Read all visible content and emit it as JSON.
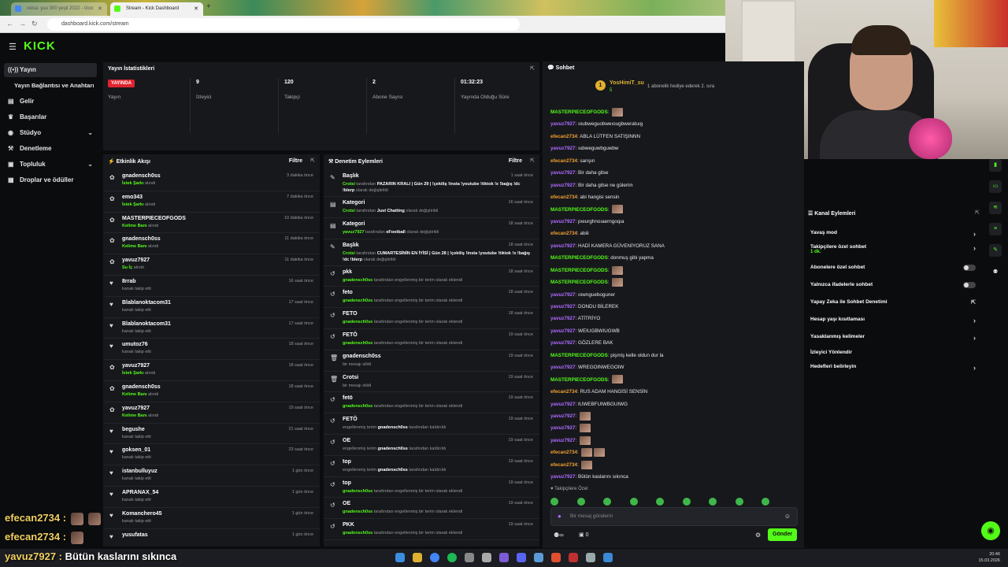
{
  "browser": {
    "tabs": [
      {
        "label": "velsa: yuu 300 yeşil 2022 - Goo"
      },
      {
        "label": "Stream - Kick Dashboard"
      }
    ],
    "url": "dashboard.kick.com/stream"
  },
  "sidebar": {
    "items": [
      {
        "label": "Yayın",
        "icon": "broadcast-icon"
      },
      {
        "label": "Yayın Bağlantısı ve Anahtarı",
        "icon": "key-icon"
      },
      {
        "label": "Gelir",
        "icon": "wallet-icon"
      },
      {
        "label": "Başarılar",
        "icon": "trophy-icon"
      },
      {
        "label": "Stüdyo",
        "icon": "studio-icon"
      },
      {
        "label": "Denetleme",
        "icon": "hammer-icon"
      },
      {
        "label": "Topluluk",
        "icon": "community-icon"
      },
      {
        "label": "Droplar ve ödüller",
        "icon": "gift-icon"
      }
    ]
  },
  "stats": {
    "title": "Yayın İstatistikleri",
    "live_badge": "YAYINDA",
    "items": [
      {
        "value": "",
        "label": "Yayın"
      },
      {
        "value": "9",
        "label": "İzleyici"
      },
      {
        "value": "120",
        "label": "Takipçi"
      },
      {
        "value": "2",
        "label": "Abone Sayısı"
      },
      {
        "value": "01:32:23",
        "label": "Yayında Olduğu Süre"
      }
    ]
  },
  "activity": {
    "title": "Etkinlik Akışı",
    "filter": "Filtre",
    "rows": [
      {
        "name": "gnadensch0ss",
        "action": "İstek Şarkı",
        "rest": " alındı",
        "time": "3 dakika önce",
        "icon": "reward-icon"
      },
      {
        "name": "emo343",
        "action": "İstek Şarkı",
        "rest": " alındı",
        "time": "7 dakika önce",
        "icon": "reward-icon"
      },
      {
        "name": "MASTERPIECEOFGODS",
        "action": "Kelime Banı",
        "rest": " alındı",
        "time": "10 dakika önce",
        "icon": "reward-icon"
      },
      {
        "name": "gnadensch0ss",
        "action": "Kelime Banı",
        "rest": " alındı",
        "time": "11 dakika önce",
        "icon": "reward-icon"
      },
      {
        "name": "yavuz7927",
        "action": "Su İç",
        "rest": " alındı",
        "time": "11 dakika önce",
        "icon": "reward-icon"
      },
      {
        "name": "8rrab",
        "action": "",
        "rest": "kanalı takip etti",
        "time": "16 saat önce",
        "icon": "heart-icon"
      },
      {
        "name": "Blablanoktacom31",
        "action": "",
        "rest": "kanalı takip etti",
        "time": "17 saat önce",
        "icon": "heart-icon"
      },
      {
        "name": "Blablanoktacom31",
        "action": "",
        "rest": "kanalı takip etti",
        "time": "17 saat önce",
        "icon": "heart-icon"
      },
      {
        "name": "umutoz76",
        "action": "",
        "rest": "kanalı takip etti",
        "time": "18 saat önce",
        "icon": "heart-icon"
      },
      {
        "name": "yavuz7927",
        "action": "İstek Şarkı",
        "rest": " alındı",
        "time": "18 saat önce",
        "icon": "reward-icon"
      },
      {
        "name": "gnadensch0ss",
        "action": "Kelime Banı",
        "rest": " alındı",
        "time": "18 saat önce",
        "icon": "reward-icon"
      },
      {
        "name": "yavuz7927",
        "action": "Kelime Banı",
        "rest": " alındı",
        "time": "19 saat önce",
        "icon": "reward-icon"
      },
      {
        "name": "begushe",
        "action": "",
        "rest": "kanalı takip etti",
        "time": "21 saat önce",
        "icon": "heart-icon"
      },
      {
        "name": "goksen_01",
        "action": "",
        "rest": "kanalı takip etti",
        "time": "23 saat önce",
        "icon": "heart-icon"
      },
      {
        "name": "istanbulluyuz",
        "action": "",
        "rest": "kanalı takip etti",
        "time": "1 gün önce",
        "icon": "heart-icon"
      },
      {
        "name": "APRANAX_54",
        "action": "",
        "rest": "kanalı takip etti",
        "time": "1 gün önce",
        "icon": "heart-icon"
      },
      {
        "name": "Komanchero45",
        "action": "",
        "rest": "kanalı takip etti",
        "time": "1 gün önce",
        "icon": "heart-icon"
      },
      {
        "name": "yusufatas",
        "action": "",
        "rest": "",
        "time": "1 gün önce",
        "icon": "heart-icon"
      }
    ]
  },
  "moderation": {
    "title": "Denetim Eylemleri",
    "filter": "Filtre",
    "rows": [
      {
        "title": "Başlık",
        "user": "Crotsi",
        "mid": " tarafından ",
        "hl": "PAZARIN KRALI | Gün 29 | !çekiliş !insta !youtube !tiktok !x !bağış !dc !blerp",
        "end": " olarak değiştirildi",
        "time": "1 saat önce",
        "icon": "title-icon"
      },
      {
        "title": "Kategori",
        "user": "Crotsi",
        "mid": " tarafından ",
        "hl": "Just Chatting",
        "end": " olarak değiştirildi",
        "time": "16 saat önce",
        "icon": "category-icon"
      },
      {
        "title": "Kategori",
        "user": "yavuz7927",
        "mid": " tarafından ",
        "hl": "eFootball",
        "end": " olarak değiştirildi",
        "time": "18 saat önce",
        "icon": "category-icon"
      },
      {
        "title": "Başlık",
        "user": "Crotsi",
        "mid": " tarafından ",
        "hl": "CUMARTESİNİN EN İYİSİ | Gün 28 | !çekiliş !insta !youtube !tiktok !x !bağış !dc !blerp",
        "end": " olarak değiştirildi",
        "time": "18 saat önce",
        "icon": "title-icon"
      },
      {
        "title": "pkk",
        "user": "gnadensch0ss",
        "mid": " tarafından engellenmiş bir terim olarak eklendi",
        "hl": "",
        "end": "",
        "time": "18 saat önce",
        "icon": "undo-icon"
      },
      {
        "title": "feto",
        "user": "gnadensch0ss",
        "mid": " tarafından engellenmiş bir terim olarak eklendi",
        "hl": "",
        "end": "",
        "time": "18 saat önce",
        "icon": "undo-icon"
      },
      {
        "title": "FETO",
        "user": "gnadensch0ss",
        "mid": " tarafından engellenmiş bir terim olarak eklendi",
        "hl": "",
        "end": "",
        "time": "18 saat önce",
        "icon": "undo-icon"
      },
      {
        "title": "FETÖ",
        "user": "gnadensch0ss",
        "mid": " tarafından engellenmiş bir terim olarak eklendi",
        "hl": "",
        "end": "",
        "time": "19 saat önce",
        "icon": "undo-icon"
      },
      {
        "title": "gnadensch0ss",
        "user": "",
        "mid": "bir mesajı silidi",
        "hl": "",
        "end": "",
        "time": "19 saat önce",
        "icon": "trash-icon"
      },
      {
        "title": "Crotsi",
        "user": "",
        "mid": "bir mesajı silidi",
        "hl": "",
        "end": "",
        "time": "19 saat önce",
        "icon": "trash-icon"
      },
      {
        "title": "fetö",
        "user": "gnadensch0ss",
        "mid": " tarafından engellenmiş bir terim olarak eklendi",
        "hl": "",
        "end": "",
        "time": "19 saat önce",
        "icon": "undo-icon"
      },
      {
        "title": "FETÖ",
        "user": "",
        "mid": "engellenmiş terim ",
        "hl": "gnadensch0ss",
        "end": " tarafından kaldırıldı",
        "time": "19 saat önce",
        "icon": "undo-icon"
      },
      {
        "title": "OE",
        "user": "",
        "mid": "engellenmiş terim ",
        "hl": "gnadensch0ss",
        "end": " tarafından kaldırıldı",
        "time": "19 saat önce",
        "icon": "undo-icon"
      },
      {
        "title": "top",
        "user": "",
        "mid": "engellenmiş terim ",
        "hl": "gnadensch0ss",
        "end": " tarafından kaldırıldı",
        "time": "19 saat önce",
        "icon": "undo-icon"
      },
      {
        "title": "top",
        "user": "gnadensch0ss",
        "mid": " tarafından engellenmiş bir terim olarak eklendi",
        "hl": "",
        "end": "",
        "time": "19 saat önce",
        "icon": "undo-icon"
      },
      {
        "title": "OE",
        "user": "gnadensch0ss",
        "mid": " tarafından engellenmiş bir terim olarak eklendi",
        "hl": "",
        "end": "",
        "time": "19 saat önce",
        "icon": "undo-icon"
      },
      {
        "title": "PKK",
        "user": "gnadensch0ss",
        "mid": " tarafından engellenmiş bir terim olarak eklendi",
        "hl": "",
        "end": "",
        "time": "19 saat önce",
        "icon": "undo-icon"
      }
    ]
  },
  "chat": {
    "title": "Sohbet",
    "pinned_user": "YosHimiT_su",
    "pinned_count": "5",
    "pinned_msg": "1 abonelik hediye ederek 2. sıra",
    "messages": [
      {
        "user": "MASTERPIECEOFGODS",
        "color": "g",
        "text": "",
        "emotes": 1
      },
      {
        "user": "yavuz7927",
        "color": "p",
        "text": "ıoubweguobweıougbweratuıg",
        "emotes": 0
      },
      {
        "user": "efecan2734",
        "color": "o",
        "text": "ABLA LÜTFEN SATIŞINNN",
        "emotes": 0
      },
      {
        "user": "yavuz7927",
        "color": "p",
        "text": "ıubweguwbguwbw",
        "emotes": 0
      },
      {
        "user": "efecan2734",
        "color": "o",
        "text": "sarışın",
        "emotes": 0
      },
      {
        "user": "yavuz7927",
        "color": "p",
        "text": "Bir daha gitse",
        "emotes": 0
      },
      {
        "user": "yavuz7927",
        "color": "p",
        "text": "Bir daha gitse ne gülerim",
        "emotes": 0
      },
      {
        "user": "efecan2734",
        "color": "o",
        "text": "abi hangisi sensin",
        "emotes": 0
      },
      {
        "user": "MASTERPIECEOFGODS",
        "color": "g",
        "text": "",
        "emotes": 1
      },
      {
        "user": "yavuz7927",
        "color": "p",
        "text": "pıeurghnoıaerngoqıa",
        "emotes": 0
      },
      {
        "user": "efecan2734",
        "color": "o",
        "text": "abiii",
        "emotes": 0
      },
      {
        "user": "yavuz7927",
        "color": "p",
        "text": "HADİ KAMERA GÜVENİYORUZ SANA",
        "emotes": 0
      },
      {
        "user": "MASTERPIECEOFGODS",
        "color": "g",
        "text": "donmuş gibi yapma",
        "emotes": 0
      },
      {
        "user": "MASTERPIECEOFGODS",
        "color": "g",
        "text": "",
        "emotes": 1
      },
      {
        "user": "MASTERPIECEOFGODS",
        "color": "g",
        "text": "",
        "emotes": 1
      },
      {
        "user": "yavuz7927",
        "color": "p",
        "text": "ıowngueboguner",
        "emotes": 0
      },
      {
        "user": "yavuz7927",
        "color": "p",
        "text": "DONDU BİLEREK",
        "emotes": 0
      },
      {
        "user": "yavuz7927",
        "color": "p",
        "text": "ATİTRİYO",
        "emotes": 0
      },
      {
        "user": "yavuz7927",
        "color": "p",
        "text": "WEIUGBWIUGWB",
        "emotes": 0
      },
      {
        "user": "yavuz7927",
        "color": "p",
        "text": "GÖZLERE BAK",
        "emotes": 0
      },
      {
        "user": "MASTERPIECEOFGODS",
        "color": "g",
        "text": "pişmiş kelle oldun dur la",
        "emotes": 0
      },
      {
        "user": "yavuz7927",
        "color": "p",
        "text": "WREGOINWEGOIW",
        "emotes": 0
      },
      {
        "user": "MASTERPIECEOFGODS",
        "color": "g",
        "text": "",
        "emotes": 1
      },
      {
        "user": "efecan2734",
        "color": "o",
        "text": "RUS ADAM HANGİSİ SENSİN",
        "emotes": 0
      },
      {
        "user": "yavuz7927",
        "color": "p",
        "text": "IUWEBFUIWBGUIWG",
        "emotes": 0
      },
      {
        "user": "yavuz7927",
        "color": "p",
        "text": "",
        "emotes": 1
      },
      {
        "user": "yavuz7927",
        "color": "p",
        "text": "",
        "emotes": 1
      },
      {
        "user": "yavuz7927",
        "color": "p",
        "text": "",
        "emotes": 1
      },
      {
        "user": "efecan2734",
        "color": "o",
        "text": "",
        "emotes": 2
      },
      {
        "user": "efecan2734",
        "color": "o",
        "text": "",
        "emotes": 1
      },
      {
        "user": "yavuz7927",
        "color": "p",
        "text": "Bütün kaslarını sıkınca",
        "emotes": 0
      }
    ],
    "follow_only": "Takipçilere Özel",
    "placeholder": "Bir mesaj gönderin",
    "sub_count": "0",
    "send_label": "Gönder"
  },
  "channel_actions": {
    "title": "Kanal Eylemleri",
    "items": [
      {
        "label": "Yavaş mod",
        "type": "arrow",
        "sub": ""
      },
      {
        "label": "Takipçilere özel sohbet",
        "type": "arrow",
        "sub": "1 dk."
      },
      {
        "label": "Abonelere özel sohbet",
        "type": "toggle",
        "sub": ""
      },
      {
        "label": "Yalnızca ifadelerle sohbet",
        "type": "toggle",
        "sub": ""
      },
      {
        "label": "Yapay Zeka ile Sohbet Denetimi",
        "type": "external",
        "sub": ""
      },
      {
        "label": "Hesap yaşı kısıtlaması",
        "type": "arrow",
        "sub": ""
      },
      {
        "label": "Yasaklanmış kelimeler",
        "type": "arrow",
        "sub": ""
      },
      {
        "label": "İzleyici Yönlendir",
        "type": "none",
        "sub": ""
      },
      {
        "label": "Hedefleri belirleyin",
        "type": "arrow",
        "sub": ""
      }
    ]
  },
  "overlay_chat": [
    {
      "user": "efecan2734",
      "sep": " :",
      "text": ""
    },
    {
      "user": "efecan2734",
      "sep": " :",
      "text": ""
    },
    {
      "user": "yavuz7927",
      "sep": " : ",
      "text": "Bütün kaslarını sıkınca"
    }
  ],
  "clock": {
    "time": "20:46",
    "date": "15.03.2026"
  },
  "colors": {
    "kick_green": "#53fc18",
    "live_red": "#e0242f",
    "panel": "#17181c"
  }
}
